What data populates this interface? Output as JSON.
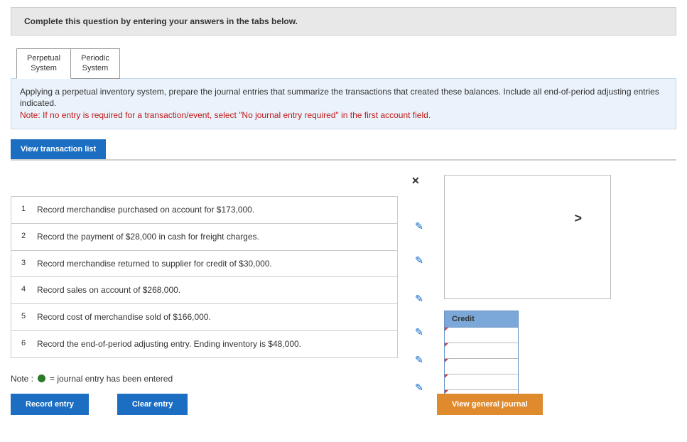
{
  "header": {
    "instruction": "Complete this question by entering your answers in the tabs below."
  },
  "tabs": {
    "tab1": "Perpetual System",
    "tab2": "Periodic System"
  },
  "instruction_box": {
    "main": "Applying a perpetual inventory system, prepare the journal entries that summarize the transactions that created these balances. Include all end-of-period adjusting entries indicated.",
    "note_label": "Note:",
    "note_text": " If no entry is required for a transaction/event, select \"No journal entry required\" in the first account field."
  },
  "view_btn": "View transaction list",
  "transactions": [
    {
      "num": "1",
      "text": "Record merchandise purchased on account for $173,000."
    },
    {
      "num": "2",
      "text": "Record the payment of $28,000 in cash for freight charges."
    },
    {
      "num": "3",
      "text": "Record merchandise returned to supplier for credit of $30,000."
    },
    {
      "num": "4",
      "text": "Record sales on account of $268,000."
    },
    {
      "num": "5",
      "text": "Record cost of merchandise sold of $166,000."
    },
    {
      "num": "6",
      "text": "Record the end-of-period adjusting entry. Ending inventory is $48,000."
    }
  ],
  "entry": {
    "credit_header": "Credit",
    "arrow": ">"
  },
  "close_icon": "✕",
  "edit_icon": "✎",
  "note_row": {
    "label": "Note :",
    "text": "= journal entry has been entered"
  },
  "buttons": {
    "record": "Record entry",
    "clear": "Clear entry",
    "vgj": "View general journal"
  }
}
